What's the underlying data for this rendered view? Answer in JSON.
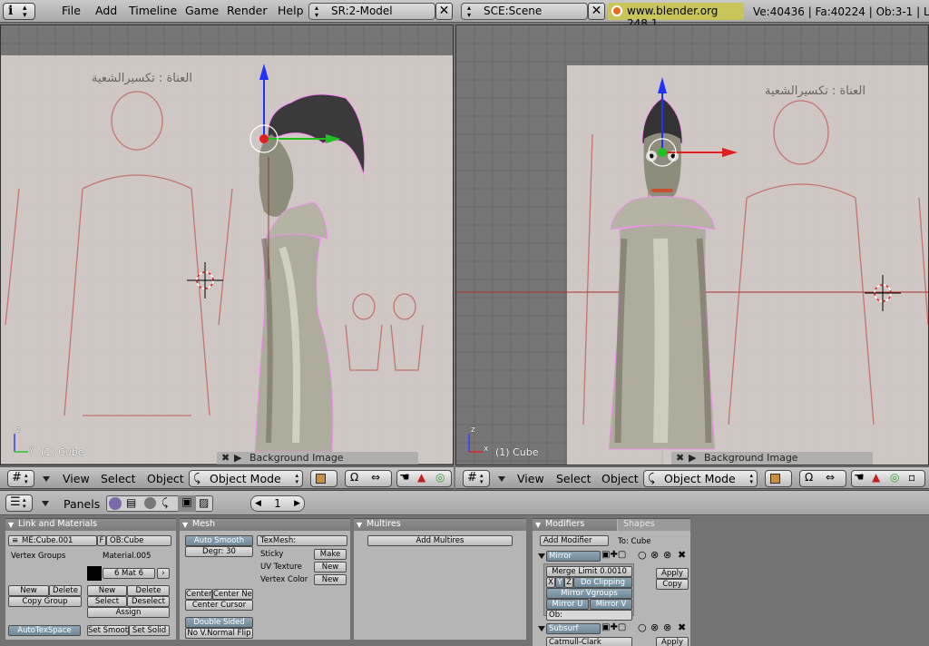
{
  "menubar": {
    "items": [
      "File",
      "Add",
      "Timeline",
      "Game",
      "Render",
      "Help"
    ],
    "screen": "SR:2-Model",
    "scene": "SCE:Scene",
    "url": "www.blender.org 248.1",
    "stats": "Ve:40436 | Fa:40224 | Ob:3-1 | L"
  },
  "viewports": [
    {
      "label": "(1) Cube",
      "axis_x": "y",
      "axis_y": "z",
      "bg_label": "Background Image"
    },
    {
      "label": "(1) Cube",
      "axis_x": "x",
      "axis_y": "z",
      "bg_label": "Background Image"
    }
  ],
  "view_header": {
    "view": "View",
    "select": "Select",
    "object": "Object",
    "mode": "Object Mode"
  },
  "buttons_header": {
    "panels": "Panels",
    "frame": "1"
  },
  "link_materials": {
    "title": "Link and Materials",
    "me": "ME:Cube.001",
    "ob_prefix": "F",
    "ob": "OB:Cube",
    "vgroups": "Vertex Groups",
    "material": "Material.005",
    "mat_slot": "6 Mat 6",
    "new": "New",
    "delete": "Delete",
    "copy_group": "Copy Group",
    "new2": "New",
    "delete2": "Delete",
    "select": "Select",
    "deselect": "Deselect",
    "assign": "Assign",
    "autotex": "AutoTexSpace",
    "set_smooth": "Set Smooth",
    "set_solid": "Set Solid"
  },
  "mesh": {
    "title": "Mesh",
    "auto_smooth": "Auto Smooth",
    "degr": "Degr: 30",
    "texmesh": "TexMesh:",
    "sticky": "Sticky",
    "uv_texture": "UV Texture",
    "vertex_color": "Vertex Color",
    "make": "Make",
    "new1": "New",
    "new2": "New",
    "center": "Center",
    "center_new": "Center New",
    "center_cursor": "Center Cursor",
    "double_sided": "Double Sided",
    "no_vnormal_flip": "No V.Normal Flip"
  },
  "multires": {
    "title": "Multires",
    "add": "Add Multires"
  },
  "modifiers": {
    "tab_modifiers": "Modifiers",
    "tab_shapes": "Shapes",
    "add_modifier": "Add Modifier",
    "to": "To: Cube",
    "mirror": "Mirror",
    "merge_limit": "Merge Limit 0.0010",
    "x": "X",
    "y": "Y",
    "z": "Z",
    "do_clipping": "Do Clipping",
    "mirror_vgroups": "Mirror Vgroups",
    "mirror_u": "Mirror U",
    "mirror_v": "Mirror V",
    "ob": "Ob:",
    "apply": "Apply",
    "copy": "Copy",
    "subsurf": "Subsurf",
    "catmull": "Catmull-Clark",
    "apply2": "Apply"
  },
  "colors": {
    "viewport_bg": "#767676",
    "grid": "#6a6a6a",
    "axis_red": "#c03030",
    "axis_green": "#30a030",
    "panel": "#b5b5b5",
    "panel_title": "#848484",
    "button": "#d0d0d0",
    "selected": "#7b90a0",
    "highlight_yellow": "#c8c65a"
  }
}
